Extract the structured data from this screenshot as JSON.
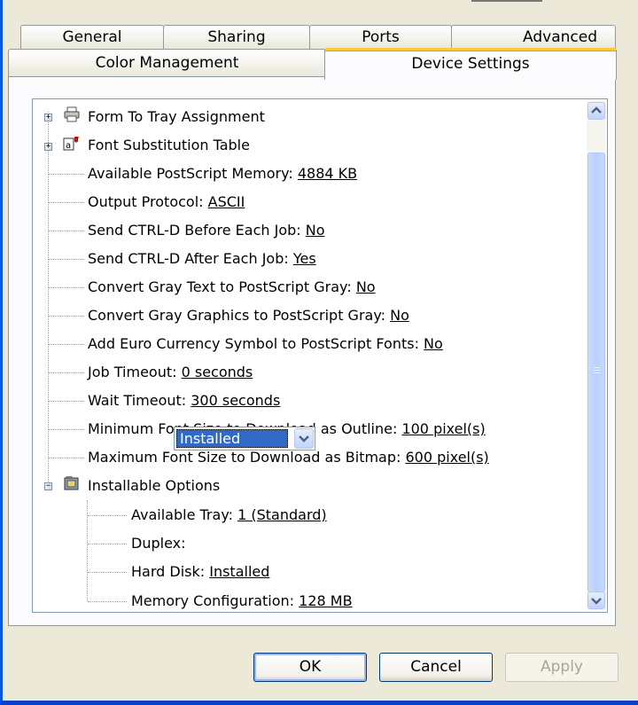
{
  "tabs_row1": [
    "General",
    "Sharing",
    "Ports",
    "Advanced"
  ],
  "tabs_row2": [
    "Color Management",
    "Device Settings"
  ],
  "active_tab": "Device Settings",
  "tree": {
    "form_to_tray": "Form To Tray Assignment",
    "font_substitution": "Font Substitution Table",
    "items": [
      {
        "label": "Available PostScript Memory: ",
        "value": "4884 KB"
      },
      {
        "label": "Output Protocol: ",
        "value": "ASCII"
      },
      {
        "label": "Send CTRL-D Before Each Job: ",
        "value": "No"
      },
      {
        "label": "Send CTRL-D After Each Job: ",
        "value": "Yes"
      },
      {
        "label": "Convert Gray Text to PostScript Gray: ",
        "value": "No"
      },
      {
        "label": "Convert Gray Graphics to PostScript Gray: ",
        "value": "No"
      },
      {
        "label": "Add Euro Currency Symbol to PostScript Fonts: ",
        "value": "No"
      },
      {
        "label": "Job Timeout: ",
        "value": "0 seconds"
      },
      {
        "label": "Wait Timeout: ",
        "value": "300 seconds"
      },
      {
        "label": "Minimum Font Size to Download as Outline: ",
        "value": "100 pixel(s)"
      },
      {
        "label": "Maximum Font Size to Download as Bitmap: ",
        "value": "600 pixel(s)"
      }
    ],
    "installable_options": "Installable Options",
    "options": {
      "available_tray_label": "Available Tray: ",
      "available_tray_value": "1 (Standard)",
      "duplex_label": "Duplex:",
      "duplex_value": "Installed",
      "hard_disk_label": "Hard Disk: ",
      "hard_disk_value": "Installed",
      "memory_label": "Memory Configuration: ",
      "memory_value": "128 MB"
    }
  },
  "buttons": {
    "ok": "OK",
    "cancel": "Cancel",
    "apply": "Apply"
  },
  "colors": {
    "selection": "#316AC5",
    "tab_highlight": "#FFC83C",
    "dialog_bg": "#ECE9D8"
  }
}
